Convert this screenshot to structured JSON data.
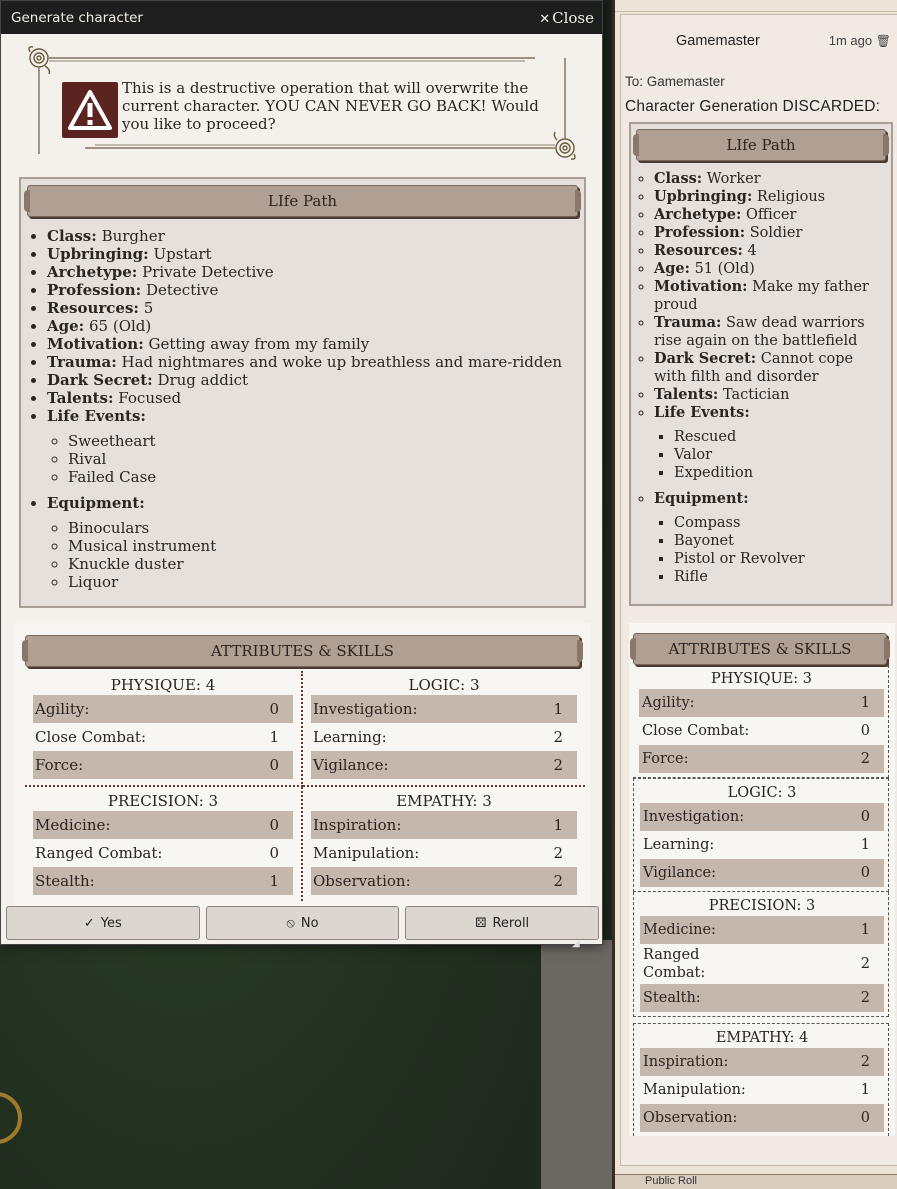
{
  "dialog": {
    "title": "Generate character",
    "close_label": "Close",
    "warning_text": "This is a destructive operation that will overwrite the current character. YOU CAN NEVER GO BACK! Would you like to proceed?",
    "lifepath": {
      "title": "LIfe Path",
      "items": [
        {
          "label": "Class:",
          "value": "Burgher"
        },
        {
          "label": "Upbringing:",
          "value": "Upstart"
        },
        {
          "label": "Archetype:",
          "value": "Private Detective"
        },
        {
          "label": "Profession:",
          "value": "Detective"
        },
        {
          "label": "Resources:",
          "value": "5"
        },
        {
          "label": "Age:",
          "value": "65 (Old)"
        },
        {
          "label": "Motivation:",
          "value": "Getting away from my family"
        },
        {
          "label": "Trauma:",
          "value": "Had nightmares and woke up breathless and mare-ridden"
        },
        {
          "label": "Dark Secret:",
          "value": "Drug addict"
        },
        {
          "label": "Talents:",
          "value": "Focused"
        }
      ],
      "life_events_label": "Life Events:",
      "life_events": [
        "Sweetheart",
        "Rival",
        "Failed Case"
      ],
      "equipment_label": "Equipment:",
      "equipment": [
        "Binoculars",
        "Musical instrument",
        "Knuckle duster",
        "Liquor"
      ]
    },
    "attributes": {
      "title": "ATTRIBUTES & SKILLS",
      "groups": [
        {
          "title": "PHYSIQUE: 4",
          "skills": [
            {
              "name": "Agility:",
              "value": "0"
            },
            {
              "name": "Close Combat:",
              "value": "1"
            },
            {
              "name": "Force:",
              "value": "0"
            }
          ]
        },
        {
          "title": "LOGIC: 3",
          "skills": [
            {
              "name": "Investigation:",
              "value": "1"
            },
            {
              "name": "Learning:",
              "value": "2"
            },
            {
              "name": "Vigilance:",
              "value": "2"
            }
          ]
        },
        {
          "title": "PRECISION: 3",
          "skills": [
            {
              "name": "Medicine:",
              "value": "0"
            },
            {
              "name": "Ranged Combat:",
              "value": "0"
            },
            {
              "name": "Stealth:",
              "value": "1"
            }
          ]
        },
        {
          "title": "EMPATHY: 3",
          "skills": [
            {
              "name": "Inspiration:",
              "value": "1"
            },
            {
              "name": "Manipulation:",
              "value": "2"
            },
            {
              "name": "Observation:",
              "value": "2"
            }
          ]
        }
      ]
    },
    "buttons": {
      "yes": "Yes",
      "no": "No",
      "reroll": "Reroll"
    }
  },
  "chat": {
    "sender": "Gamemaster",
    "time": "1m ago",
    "to": "To: Gamemaster",
    "heading": "Character Generation DISCARDED:",
    "lifepath": {
      "title": "LIfe Path",
      "items": [
        {
          "label": "Class:",
          "value": "Worker"
        },
        {
          "label": "Upbringing:",
          "value": "Religious"
        },
        {
          "label": "Archetype:",
          "value": "Officer"
        },
        {
          "label": "Profession:",
          "value": "Soldier"
        },
        {
          "label": "Resources:",
          "value": "4"
        },
        {
          "label": "Age:",
          "value": "51 (Old)"
        },
        {
          "label": "Motivation:",
          "value": "Make my father proud"
        },
        {
          "label": "Trauma:",
          "value": "Saw dead warriors rise again on the battlefield"
        },
        {
          "label": "Dark Secret:",
          "value": "Cannot cope with filth and disorder"
        },
        {
          "label": "Talents:",
          "value": "Tactician"
        }
      ],
      "life_events_label": "Life Events:",
      "life_events": [
        "Rescued",
        "Valor",
        "Expedition"
      ],
      "equipment_label": "Equipment:",
      "equipment": [
        "Compass",
        "Bayonet",
        "Pistol or Revolver",
        "Rifle"
      ]
    },
    "attributes": {
      "title": "ATTRIBUTES & SKILLS",
      "groups": [
        {
          "title": "PHYSIQUE: 3",
          "skills": [
            {
              "name": "Agility:",
              "value": "1"
            },
            {
              "name": "Close Combat:",
              "value": "0"
            },
            {
              "name": "Force:",
              "value": "2"
            }
          ]
        },
        {
          "title": "LOGIC: 3",
          "skills": [
            {
              "name": "Investigation:",
              "value": "0"
            },
            {
              "name": "Learning:",
              "value": "1"
            },
            {
              "name": "Vigilance:",
              "value": "0"
            }
          ]
        },
        {
          "title": "PRECISION: 3",
          "skills": [
            {
              "name": "Medicine:",
              "value": "1"
            },
            {
              "name": "Ranged Combat:",
              "value": "2"
            },
            {
              "name": "Stealth:",
              "value": "2"
            }
          ]
        },
        {
          "title": "EMPATHY: 4",
          "skills": [
            {
              "name": "Inspiration:",
              "value": "2"
            },
            {
              "name": "Manipulation:",
              "value": "1"
            },
            {
              "name": "Observation:",
              "value": "0"
            }
          ]
        }
      ]
    },
    "bottom_label": "Public Roll"
  }
}
